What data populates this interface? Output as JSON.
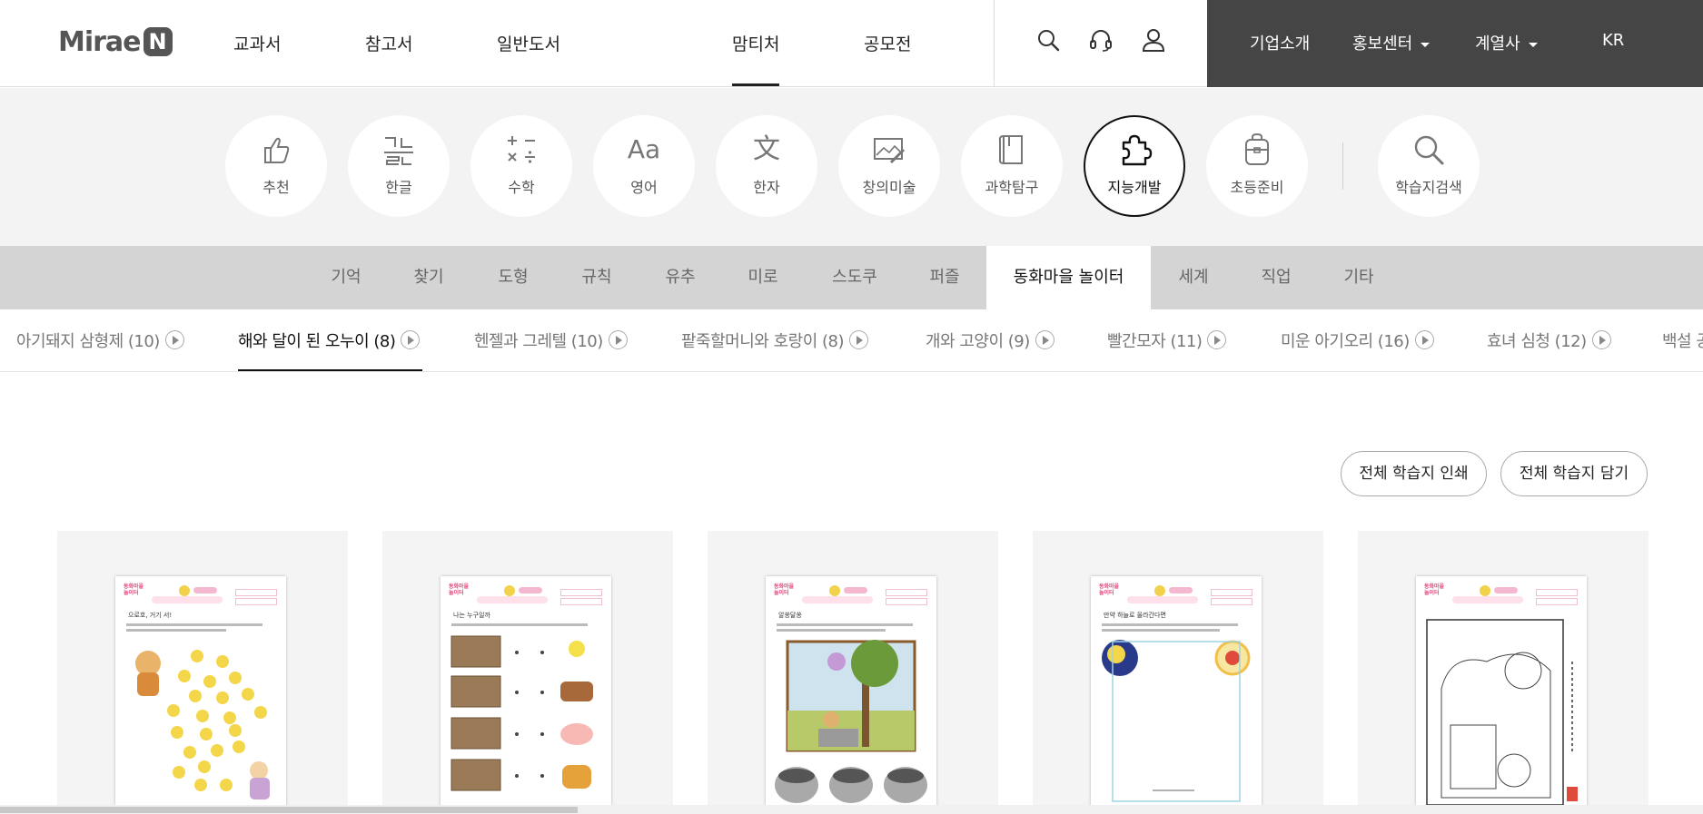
{
  "header": {
    "logo_text": "Mirae",
    "logo_mark": "N",
    "gnb": [
      "교과서",
      "참고서",
      "일반도서",
      "맘티처",
      "공모전"
    ],
    "active_gnb": "맘티처",
    "icons": [
      "search-icon",
      "headset-icon",
      "user-icon"
    ],
    "corp_menu": [
      {
        "label": "기업소개",
        "dropdown": false
      },
      {
        "label": "홍보센터",
        "dropdown": true
      },
      {
        "label": "계열사",
        "dropdown": true
      },
      {
        "label": "KR",
        "dropdown": false
      }
    ],
    "colors": {
      "corp_bg": "#454545"
    }
  },
  "categories": {
    "items": [
      {
        "label": "추천",
        "icon": "thumbs-up-icon"
      },
      {
        "label": "한글",
        "icon": "hangul-icon"
      },
      {
        "label": "수학",
        "icon": "math-symbols-icon"
      },
      {
        "label": "영어",
        "icon": "aa-letters-icon"
      },
      {
        "label": "한자",
        "icon": "hanja-icon"
      },
      {
        "label": "창의미술",
        "icon": "picture-brush-icon"
      },
      {
        "label": "과학탐구",
        "icon": "notebook-icon"
      },
      {
        "label": "지능개발",
        "icon": "puzzle-icon"
      },
      {
        "label": "초등준비",
        "icon": "backpack-icon"
      }
    ],
    "active": "지능개발",
    "search": {
      "label": "학습지검색",
      "icon": "magnifier-icon"
    }
  },
  "sub_tabs": {
    "items": [
      "기억",
      "찾기",
      "도형",
      "규칙",
      "유추",
      "미로",
      "스도쿠",
      "퍼즐",
      "동화마을 놀이터",
      "세계",
      "직업",
      "기타"
    ],
    "active": "동화마을 놀이터"
  },
  "story_tabs": {
    "items": [
      "아기돼지 삼형제 (10)",
      "해와 달이 된 오누이 (8)",
      "헨젤과 그레텔 (10)",
      "팥죽할머니와 호랑이 (8)",
      "개와 고양이 (9)",
      "빨간모자 (11)",
      "미운 아기오리 (16)",
      "효녀 심청 (12)",
      "백설 공주"
    ],
    "active": "해와 달이 된 오누이 (8)"
  },
  "actions": {
    "print_all": "전체 학습지 인쇄",
    "save_all": "전체 학습지 담기"
  },
  "worksheets": [
    {
      "badge_logo": "동화마을 놀이터",
      "heading": "으로호, 거기 서!"
    },
    {
      "badge_logo": "동화마을 놀이터",
      "heading": "나는 누구일까"
    },
    {
      "badge_logo": "동화마을 놀이터",
      "heading": "알쏭달쏭"
    },
    {
      "badge_logo": "동화마을 놀이터",
      "heading": "만약 하늘로 올라간다면"
    },
    {
      "badge_logo": "동화마을 놀이터",
      "heading": ""
    }
  ]
}
